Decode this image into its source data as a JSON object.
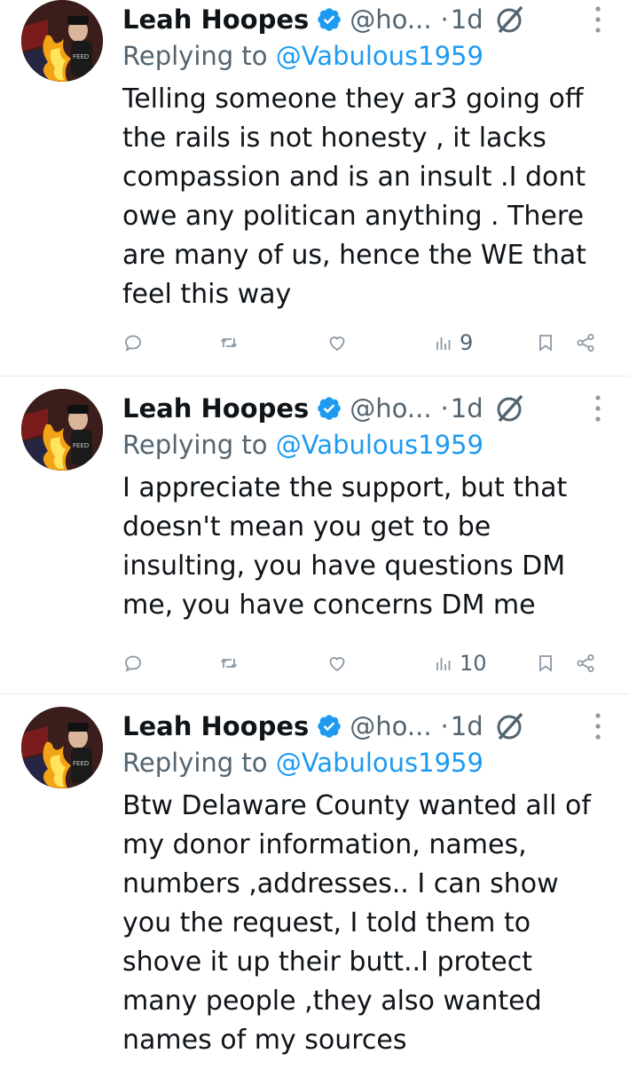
{
  "colors": {
    "link": "#1d9bf0",
    "muted": "#536471",
    "text": "#0f1419",
    "divider": "#e6ecf0"
  },
  "tweets": [
    {
      "author": "Leah Hoopes",
      "handle": "@ho...",
      "separator": "·",
      "time": "1d",
      "replying_prefix": "Replying to ",
      "replying_to": "@Vabulous1959",
      "text": "Telling someone they ar3 going off\nthe rails is not honesty , it lacks\ncompassion and is an insult .I dont\nowe any politican anything . There\nare many of us, hence the WE that\nfeel this way",
      "views": "9",
      "icons": [
        "reply-icon",
        "retweet-icon",
        "like-icon",
        "views-icon",
        "bookmark-icon",
        "share-icon"
      ]
    },
    {
      "author": "Leah Hoopes",
      "handle": "@ho...",
      "separator": "·",
      "time": "1d",
      "replying_prefix": "Replying to ",
      "replying_to": "@Vabulous1959",
      "text": "I appreciate the support, but that\ndoesn't mean you get to be\ninsulting, you have questions DM\nme, you have concerns DM me",
      "views": "10",
      "icons": [
        "reply-icon",
        "retweet-icon",
        "like-icon",
        "views-icon",
        "bookmark-icon",
        "share-icon"
      ]
    },
    {
      "author": "Leah Hoopes",
      "handle": "@ho...",
      "separator": "·",
      "time": "1d",
      "replying_prefix": "Replying to ",
      "replying_to": "@Vabulous1959",
      "text": "Btw Delaware County wanted all of\nmy donor information,  names,\nnumbers ,addresses.. I can show\nyou the request, I told them to\nshove it up their butt..I protect\nmany people  ,they also wanted\nnames of my sources"
    }
  ]
}
